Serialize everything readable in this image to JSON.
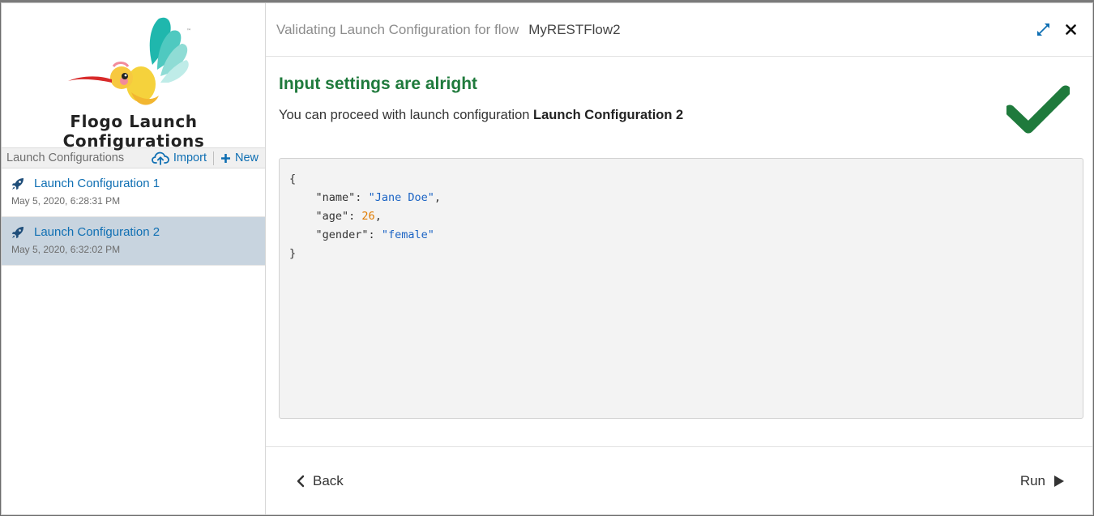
{
  "sidebar": {
    "title": "Flogo Launch Configurations",
    "toolbar": {
      "label": "Launch Configurations",
      "import_label": "Import",
      "new_label": "New"
    },
    "items": [
      {
        "name": "Launch Configuration 1",
        "date": "May 5, 2020, 6:28:31 PM"
      },
      {
        "name": "Launch Configuration 2",
        "date": "May 5, 2020, 6:32:02 PM"
      }
    ]
  },
  "header": {
    "prefix": "Validating Launch Configuration for flow",
    "flow_name": "MyRESTFlow2"
  },
  "status": {
    "title": "Input settings are alright",
    "message": "You can proceed with launch configuration",
    "config_name": "Launch Configuration 2"
  },
  "code": {
    "open": "{",
    "fields": [
      {
        "key": "\"name\"",
        "value": "\"Jane Doe\"",
        "sep": ","
      },
      {
        "key": "\"age\"",
        "value": "26",
        "sep": ","
      },
      {
        "key": "\"gender\"",
        "value": "\"female\"",
        "sep": ""
      }
    ],
    "close": "}"
  },
  "footer": {
    "back_label": "Back",
    "run_label": "Run"
  },
  "icons": {
    "logo": "hummingbird-logo",
    "import": "cloud-upload-icon",
    "new": "plus-icon",
    "config": "rocket-icon",
    "expand": "expand-icon",
    "close": "close-icon",
    "status": "checkmark-icon",
    "back": "chevron-left-icon",
    "run": "play-icon"
  },
  "colors": {
    "accent": "#0f6fb3",
    "success": "#1f7a3c",
    "selected_row": "#c8d4df",
    "json_string": "#1a63c4",
    "json_number": "#e07b00"
  }
}
